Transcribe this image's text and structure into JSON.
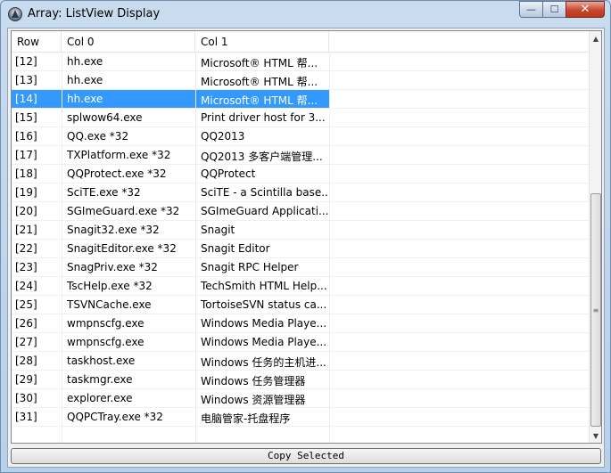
{
  "window": {
    "title": "Array: ListView Display"
  },
  "caption": {
    "minimize": "—",
    "maximize": "☐",
    "close": "✕"
  },
  "list": {
    "columns": [
      "Row",
      "Col 0",
      "Col 1"
    ],
    "selected_row": "[14]",
    "rows": [
      {
        "row": "[12]",
        "col0": "hh.exe",
        "col1": "Microsoft® HTML 帮..."
      },
      {
        "row": "[13]",
        "col0": "hh.exe",
        "col1": "Microsoft® HTML 帮..."
      },
      {
        "row": "[14]",
        "col0": "hh.exe",
        "col1": "Microsoft® HTML 帮..."
      },
      {
        "row": "[15]",
        "col0": "splwow64.exe",
        "col1": "Print driver host for 3..."
      },
      {
        "row": "[16]",
        "col0": "QQ.exe *32",
        "col1": "QQ2013"
      },
      {
        "row": "[17]",
        "col0": "TXPlatform.exe *32",
        "col1": "QQ2013 多客户端管理..."
      },
      {
        "row": "[18]",
        "col0": "QQProtect.exe *32",
        "col1": "QQProtect"
      },
      {
        "row": "[19]",
        "col0": "SciTE.exe *32",
        "col1": "SciTE - a Scintilla base..."
      },
      {
        "row": "[20]",
        "col0": "SGImeGuard.exe *32",
        "col1": "SGImeGuard Applicati..."
      },
      {
        "row": "[21]",
        "col0": "Snagit32.exe *32",
        "col1": "Snagit"
      },
      {
        "row": "[22]",
        "col0": "SnagitEditor.exe *32",
        "col1": "Snagit Editor"
      },
      {
        "row": "[23]",
        "col0": "SnagPriv.exe *32",
        "col1": "Snagit RPC Helper"
      },
      {
        "row": "[24]",
        "col0": "TscHelp.exe *32",
        "col1": "TechSmith HTML Help..."
      },
      {
        "row": "[25]",
        "col0": "TSVNCache.exe",
        "col1": "TortoiseSVN status ca..."
      },
      {
        "row": "[26]",
        "col0": "wmpnscfg.exe",
        "col1": "Windows Media Playe..."
      },
      {
        "row": "[27]",
        "col0": "wmpnscfg.exe",
        "col1": "Windows Media Playe..."
      },
      {
        "row": "[28]",
        "col0": "taskhost.exe",
        "col1": "Windows 任务的主机进..."
      },
      {
        "row": "[29]",
        "col0": "taskmgr.exe",
        "col1": "Windows 任务管理器"
      },
      {
        "row": "[30]",
        "col0": "explorer.exe",
        "col1": "Windows 资源管理器"
      },
      {
        "row": "[31]",
        "col0": "QQPCTray.exe *32",
        "col1": "电脑管家-托盘程序"
      }
    ]
  },
  "scrollbar": {
    "position": 1.0
  },
  "buttons": {
    "copy_selected": "Copy Selected"
  },
  "colors": {
    "selection": "#3399ff",
    "title_bar": "#c9dcef"
  }
}
